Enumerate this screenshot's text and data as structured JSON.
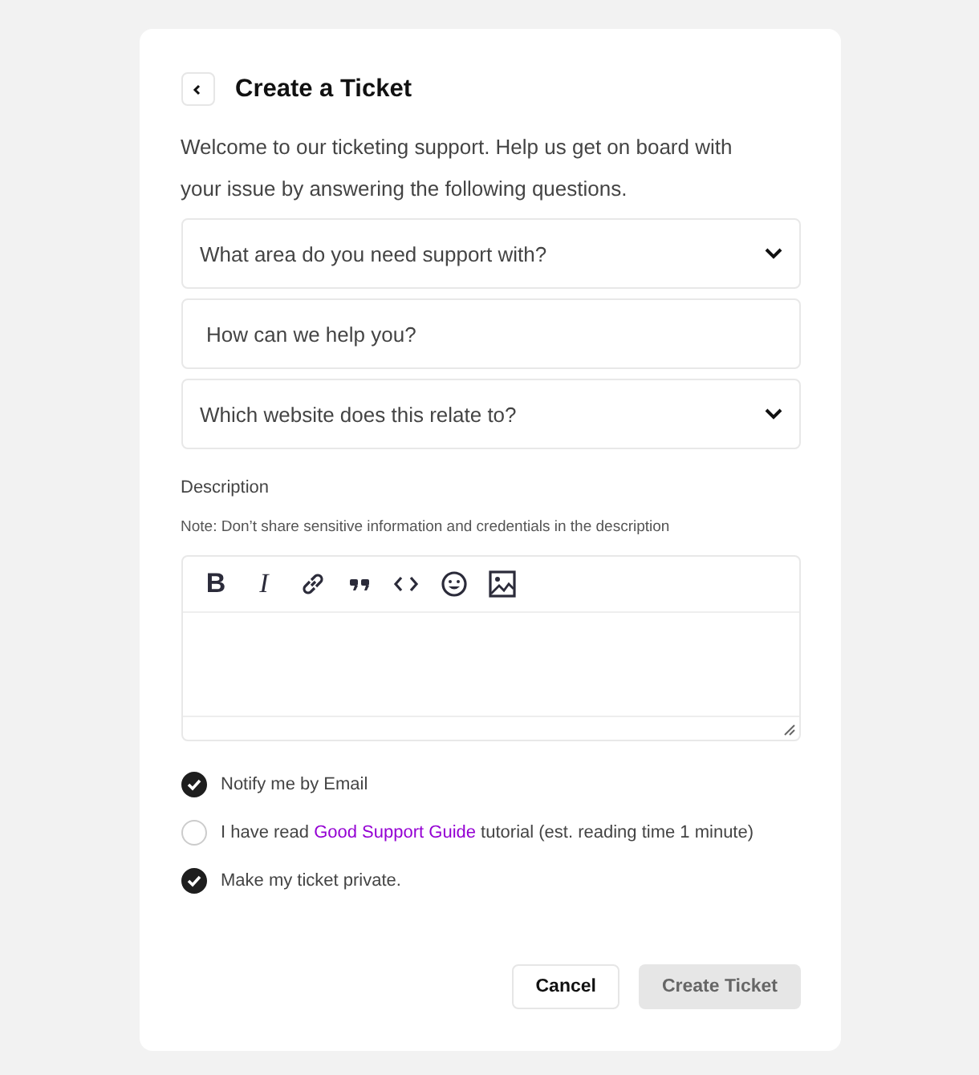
{
  "title": "Create a Ticket",
  "intro": "Welcome to our ticketing support. Help us get on board with your issue by answering the following questions.",
  "fields": [
    {
      "kind": "select",
      "placeholder": "What area do you need support with?"
    },
    {
      "kind": "input",
      "placeholder": "How can we help you?"
    },
    {
      "kind": "select",
      "placeholder": "Which website does this relate to?"
    }
  ],
  "description": {
    "label": "Description",
    "note": "Note: Don’t share sensitive information and credentials in the description",
    "toolbar": [
      {
        "kind": "bold",
        "glyph": "B"
      },
      {
        "kind": "italic",
        "glyph": "I"
      },
      {
        "kind": "link"
      },
      {
        "kind": "quote"
      },
      {
        "kind": "code"
      },
      {
        "kind": "emoji"
      },
      {
        "kind": "image"
      }
    ]
  },
  "options": [
    {
      "text_before": "Notify me by Email",
      "checked": true
    },
    {
      "text_before": "I have read ",
      "link": "Good Support Guide",
      "text_after": " tutorial (est. reading time 1 minute)",
      "checked": false
    },
    {
      "text_before": "Make my ticket private.",
      "checked": true
    }
  ],
  "buttons": [
    {
      "kind": "secondary",
      "label": "Cancel",
      "disabled": false
    },
    {
      "kind": "primary",
      "label": "Create Ticket",
      "disabled": true
    }
  ]
}
